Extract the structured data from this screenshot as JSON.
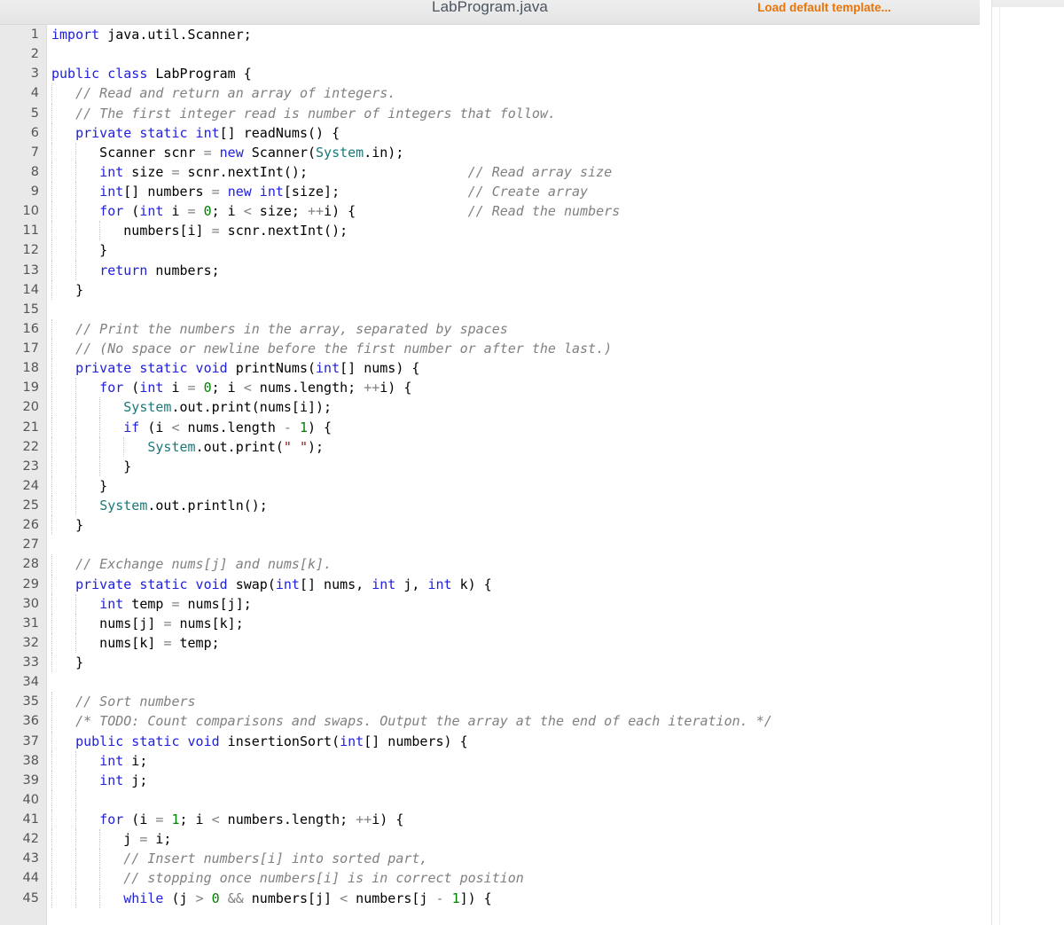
{
  "header": {
    "file_title": "LabProgram.java",
    "load_template_label": "Load default template...",
    "link_color": "#e8740c",
    "title_color": "#4a5560"
  },
  "editor": {
    "language": "java",
    "first_visible_line": 1,
    "last_visible_line": 45,
    "total_visible_lines": 45,
    "tab_size": 3,
    "gutter_color": "#e9e9e9",
    "background_color": "#ffffff",
    "syntax_colors": {
      "keyword": "#2020dd",
      "class": "#1c7878",
      "number": "#008000",
      "string": "#8b1a1a",
      "comment": "#808080",
      "operator": "#808080",
      "plain": "#000000"
    }
  },
  "code_lines": [
    {
      "n": 1,
      "indent": 0,
      "tokens": [
        {
          "c": "kw",
          "t": "import"
        },
        {
          "c": "pl",
          "t": " java.util.Scanner;"
        }
      ]
    },
    {
      "n": 2,
      "indent": 0,
      "tokens": []
    },
    {
      "n": 3,
      "indent": 0,
      "tokens": [
        {
          "c": "kw",
          "t": "public class"
        },
        {
          "c": "pl",
          "t": " LabProgram {"
        }
      ]
    },
    {
      "n": 4,
      "indent": 1,
      "tokens": [
        {
          "c": "cmt",
          "t": "   // Read and return an array of integers."
        }
      ]
    },
    {
      "n": 5,
      "indent": 1,
      "tokens": [
        {
          "c": "cmt",
          "t": "   // The first integer read is number of integers that follow."
        }
      ]
    },
    {
      "n": 6,
      "indent": 1,
      "tokens": [
        {
          "c": "pl",
          "t": "   "
        },
        {
          "c": "kw",
          "t": "private static int"
        },
        {
          "c": "pl",
          "t": "[] readNums() {"
        }
      ]
    },
    {
      "n": 7,
      "indent": 2,
      "tokens": [
        {
          "c": "pl",
          "t": "      Scanner scnr "
        },
        {
          "c": "op",
          "t": "="
        },
        {
          "c": "pl",
          "t": " "
        },
        {
          "c": "kw",
          "t": "new"
        },
        {
          "c": "pl",
          "t": " Scanner("
        },
        {
          "c": "cls",
          "t": "System"
        },
        {
          "c": "pl",
          "t": ".in);"
        }
      ]
    },
    {
      "n": 8,
      "indent": 2,
      "tokens": [
        {
          "c": "pl",
          "t": "      "
        },
        {
          "c": "kw",
          "t": "int"
        },
        {
          "c": "pl",
          "t": " size "
        },
        {
          "c": "op",
          "t": "="
        },
        {
          "c": "pl",
          "t": " scnr.nextInt();"
        }
      ],
      "trailing_comment": "// Read array size"
    },
    {
      "n": 9,
      "indent": 2,
      "tokens": [
        {
          "c": "pl",
          "t": "      "
        },
        {
          "c": "kw",
          "t": "int"
        },
        {
          "c": "pl",
          "t": "[] numbers "
        },
        {
          "c": "op",
          "t": "="
        },
        {
          "c": "pl",
          "t": " "
        },
        {
          "c": "kw",
          "t": "new int"
        },
        {
          "c": "pl",
          "t": "[size];"
        }
      ],
      "trailing_comment": "// Create array"
    },
    {
      "n": 10,
      "indent": 2,
      "tokens": [
        {
          "c": "pl",
          "t": "      "
        },
        {
          "c": "kw",
          "t": "for"
        },
        {
          "c": "pl",
          "t": " ("
        },
        {
          "c": "kw",
          "t": "int"
        },
        {
          "c": "pl",
          "t": " i "
        },
        {
          "c": "op",
          "t": "="
        },
        {
          "c": "pl",
          "t": " "
        },
        {
          "c": "num",
          "t": "0"
        },
        {
          "c": "pl",
          "t": "; i "
        },
        {
          "c": "op",
          "t": "<"
        },
        {
          "c": "pl",
          "t": " size; "
        },
        {
          "c": "op",
          "t": "++"
        },
        {
          "c": "pl",
          "t": "i) {"
        }
      ],
      "trailing_comment": "// Read the numbers"
    },
    {
      "n": 11,
      "indent": 3,
      "tokens": [
        {
          "c": "pl",
          "t": "         numbers[i] "
        },
        {
          "c": "op",
          "t": "="
        },
        {
          "c": "pl",
          "t": " scnr.nextInt();"
        }
      ]
    },
    {
      "n": 12,
      "indent": 2,
      "tokens": [
        {
          "c": "pl",
          "t": "      }"
        }
      ]
    },
    {
      "n": 13,
      "indent": 2,
      "tokens": [
        {
          "c": "pl",
          "t": "      "
        },
        {
          "c": "kw",
          "t": "return"
        },
        {
          "c": "pl",
          "t": " numbers;"
        }
      ]
    },
    {
      "n": 14,
      "indent": 1,
      "tokens": [
        {
          "c": "pl",
          "t": "   }"
        }
      ]
    },
    {
      "n": 15,
      "indent": 0,
      "tokens": []
    },
    {
      "n": 16,
      "indent": 1,
      "tokens": [
        {
          "c": "cmt",
          "t": "   // Print the numbers in the array, separated by spaces"
        }
      ]
    },
    {
      "n": 17,
      "indent": 1,
      "tokens": [
        {
          "c": "cmt",
          "t": "   // (No space or newline before the first number or after the last.)"
        }
      ]
    },
    {
      "n": 18,
      "indent": 1,
      "tokens": [
        {
          "c": "pl",
          "t": "   "
        },
        {
          "c": "kw",
          "t": "private static void"
        },
        {
          "c": "pl",
          "t": " printNums("
        },
        {
          "c": "kw",
          "t": "int"
        },
        {
          "c": "pl",
          "t": "[] nums) {"
        }
      ]
    },
    {
      "n": 19,
      "indent": 2,
      "tokens": [
        {
          "c": "pl",
          "t": "      "
        },
        {
          "c": "kw",
          "t": "for"
        },
        {
          "c": "pl",
          "t": " ("
        },
        {
          "c": "kw",
          "t": "int"
        },
        {
          "c": "pl",
          "t": " i "
        },
        {
          "c": "op",
          "t": "="
        },
        {
          "c": "pl",
          "t": " "
        },
        {
          "c": "num",
          "t": "0"
        },
        {
          "c": "pl",
          "t": "; i "
        },
        {
          "c": "op",
          "t": "<"
        },
        {
          "c": "pl",
          "t": " nums.length; "
        },
        {
          "c": "op",
          "t": "++"
        },
        {
          "c": "pl",
          "t": "i) {"
        }
      ]
    },
    {
      "n": 20,
      "indent": 3,
      "tokens": [
        {
          "c": "pl",
          "t": "         "
        },
        {
          "c": "cls",
          "t": "System"
        },
        {
          "c": "pl",
          "t": ".out.print(nums[i]);"
        }
      ]
    },
    {
      "n": 21,
      "indent": 3,
      "tokens": [
        {
          "c": "pl",
          "t": "         "
        },
        {
          "c": "kw",
          "t": "if"
        },
        {
          "c": "pl",
          "t": " (i "
        },
        {
          "c": "op",
          "t": "<"
        },
        {
          "c": "pl",
          "t": " nums.length "
        },
        {
          "c": "op",
          "t": "-"
        },
        {
          "c": "pl",
          "t": " "
        },
        {
          "c": "num",
          "t": "1"
        },
        {
          "c": "pl",
          "t": ") {"
        }
      ]
    },
    {
      "n": 22,
      "indent": 4,
      "tokens": [
        {
          "c": "pl",
          "t": "            "
        },
        {
          "c": "cls",
          "t": "System"
        },
        {
          "c": "pl",
          "t": ".out.print("
        },
        {
          "c": "str",
          "t": "\" \""
        },
        {
          "c": "pl",
          "t": ");"
        }
      ]
    },
    {
      "n": 23,
      "indent": 3,
      "tokens": [
        {
          "c": "pl",
          "t": "         }"
        }
      ]
    },
    {
      "n": 24,
      "indent": 2,
      "tokens": [
        {
          "c": "pl",
          "t": "      }"
        }
      ]
    },
    {
      "n": 25,
      "indent": 2,
      "tokens": [
        {
          "c": "pl",
          "t": "      "
        },
        {
          "c": "cls",
          "t": "System"
        },
        {
          "c": "pl",
          "t": ".out.println();"
        }
      ]
    },
    {
      "n": 26,
      "indent": 1,
      "tokens": [
        {
          "c": "pl",
          "t": "   }"
        }
      ]
    },
    {
      "n": 27,
      "indent": 0,
      "tokens": []
    },
    {
      "n": 28,
      "indent": 1,
      "tokens": [
        {
          "c": "cmt",
          "t": "   // Exchange nums[j] and nums[k]."
        }
      ]
    },
    {
      "n": 29,
      "indent": 1,
      "tokens": [
        {
          "c": "pl",
          "t": "   "
        },
        {
          "c": "kw",
          "t": "private static void"
        },
        {
          "c": "pl",
          "t": " swap("
        },
        {
          "c": "kw",
          "t": "int"
        },
        {
          "c": "pl",
          "t": "[] nums, "
        },
        {
          "c": "kw",
          "t": "int"
        },
        {
          "c": "pl",
          "t": " j, "
        },
        {
          "c": "kw",
          "t": "int"
        },
        {
          "c": "pl",
          "t": " k) {"
        }
      ]
    },
    {
      "n": 30,
      "indent": 2,
      "tokens": [
        {
          "c": "pl",
          "t": "      "
        },
        {
          "c": "kw",
          "t": "int"
        },
        {
          "c": "pl",
          "t": " temp "
        },
        {
          "c": "op",
          "t": "="
        },
        {
          "c": "pl",
          "t": " nums[j];"
        }
      ]
    },
    {
      "n": 31,
      "indent": 2,
      "tokens": [
        {
          "c": "pl",
          "t": "      nums[j] "
        },
        {
          "c": "op",
          "t": "="
        },
        {
          "c": "pl",
          "t": " nums[k];"
        }
      ]
    },
    {
      "n": 32,
      "indent": 2,
      "tokens": [
        {
          "c": "pl",
          "t": "      nums[k] "
        },
        {
          "c": "op",
          "t": "="
        },
        {
          "c": "pl",
          "t": " temp;"
        }
      ]
    },
    {
      "n": 33,
      "indent": 1,
      "tokens": [
        {
          "c": "pl",
          "t": "   }"
        }
      ]
    },
    {
      "n": 34,
      "indent": 0,
      "tokens": []
    },
    {
      "n": 35,
      "indent": 1,
      "tokens": [
        {
          "c": "cmt",
          "t": "   // Sort numbers"
        }
      ]
    },
    {
      "n": 36,
      "indent": 1,
      "tokens": [
        {
          "c": "cmt",
          "t": "   /* TODO: Count comparisons and swaps. Output the array at the end of each iteration. */"
        }
      ]
    },
    {
      "n": 37,
      "indent": 1,
      "tokens": [
        {
          "c": "pl",
          "t": "   "
        },
        {
          "c": "kw",
          "t": "public static void"
        },
        {
          "c": "pl",
          "t": " insertionSort("
        },
        {
          "c": "kw",
          "t": "int"
        },
        {
          "c": "pl",
          "t": "[] numbers) {"
        }
      ]
    },
    {
      "n": 38,
      "indent": 2,
      "tokens": [
        {
          "c": "pl",
          "t": "      "
        },
        {
          "c": "kw",
          "t": "int"
        },
        {
          "c": "pl",
          "t": " i;"
        }
      ]
    },
    {
      "n": 39,
      "indent": 2,
      "tokens": [
        {
          "c": "pl",
          "t": "      "
        },
        {
          "c": "kw",
          "t": "int"
        },
        {
          "c": "pl",
          "t": " j;"
        }
      ]
    },
    {
      "n": 40,
      "indent": 2,
      "tokens": []
    },
    {
      "n": 41,
      "indent": 2,
      "tokens": [
        {
          "c": "pl",
          "t": "      "
        },
        {
          "c": "kw",
          "t": "for"
        },
        {
          "c": "pl",
          "t": " (i "
        },
        {
          "c": "op",
          "t": "="
        },
        {
          "c": "pl",
          "t": " "
        },
        {
          "c": "num",
          "t": "1"
        },
        {
          "c": "pl",
          "t": "; i "
        },
        {
          "c": "op",
          "t": "<"
        },
        {
          "c": "pl",
          "t": " numbers.length; "
        },
        {
          "c": "op",
          "t": "++"
        },
        {
          "c": "pl",
          "t": "i) {"
        }
      ]
    },
    {
      "n": 42,
      "indent": 3,
      "tokens": [
        {
          "c": "pl",
          "t": "         j "
        },
        {
          "c": "op",
          "t": "="
        },
        {
          "c": "pl",
          "t": " i;"
        }
      ]
    },
    {
      "n": 43,
      "indent": 3,
      "tokens": [
        {
          "c": "cmt",
          "t": "         // Insert numbers[i] into sorted part,"
        }
      ]
    },
    {
      "n": 44,
      "indent": 3,
      "tokens": [
        {
          "c": "cmt",
          "t": "         // stopping once numbers[i] is in correct position"
        }
      ]
    },
    {
      "n": 45,
      "indent": 3,
      "tokens": [
        {
          "c": "pl",
          "t": "         "
        },
        {
          "c": "kw",
          "t": "while"
        },
        {
          "c": "pl",
          "t": " (j "
        },
        {
          "c": "op",
          "t": ">"
        },
        {
          "c": "pl",
          "t": " "
        },
        {
          "c": "num",
          "t": "0"
        },
        {
          "c": "pl",
          "t": " "
        },
        {
          "c": "op",
          "t": "&&"
        },
        {
          "c": "pl",
          "t": " numbers[j] "
        },
        {
          "c": "op",
          "t": "<"
        },
        {
          "c": "pl",
          "t": " numbers[j "
        },
        {
          "c": "op",
          "t": "-"
        },
        {
          "c": "pl",
          "t": " "
        },
        {
          "c": "num",
          "t": "1"
        },
        {
          "c": "pl",
          "t": "]) {"
        }
      ]
    }
  ]
}
